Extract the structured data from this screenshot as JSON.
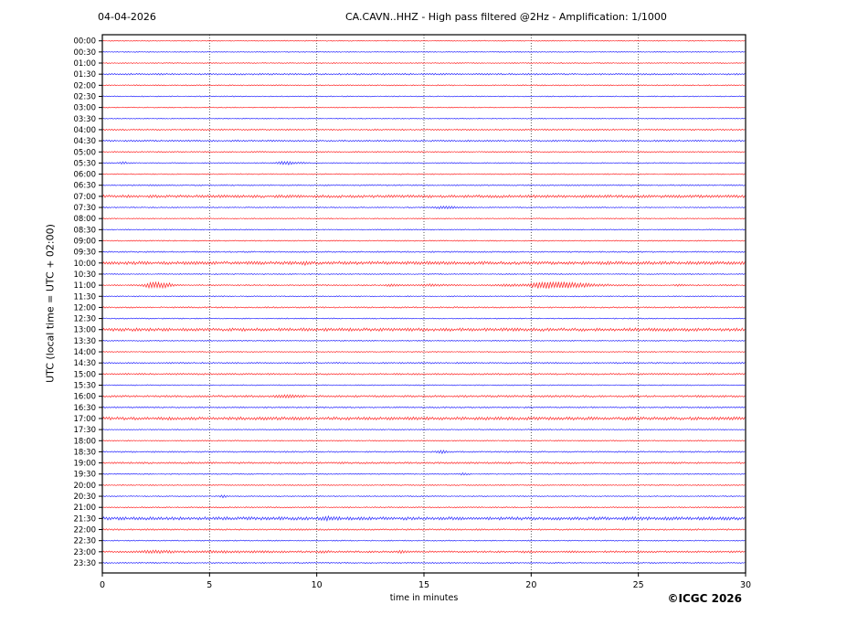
{
  "header": {
    "date": "04-04-2026",
    "title": "CA.CAVN..HHZ - High pass filtered @2Hz - Amplification: 1/1000"
  },
  "footer": {
    "copyright": "©ICGC 2026"
  },
  "chart_data": {
    "type": "line",
    "subtype": "helicorder-seismogram",
    "title": "CA.CAVN..HHZ - High pass filtered @2Hz - Amplification: 1/1000",
    "date": "04-04-2026",
    "xlabel": "time in minutes",
    "ylabel": "UTC (local time = UTC + 02:00)",
    "xlim": [
      0,
      30
    ],
    "x_ticks": [
      0,
      5,
      10,
      15,
      20,
      25,
      30
    ],
    "grid": "vertical-dotted-at-5-min",
    "legend": "none",
    "row_interval_minutes": 30,
    "colors": {
      "rows_on_hour": "#ff0000",
      "rows_on_half_hour": "#0000ff",
      "axis": "#000000",
      "grid": "#333333"
    },
    "rows": [
      {
        "label": "00:00",
        "color": "#ff0000",
        "noise": 0.5,
        "events": []
      },
      {
        "label": "00:30",
        "color": "#0000ff",
        "noise": 0.5,
        "events": []
      },
      {
        "label": "01:00",
        "color": "#ff0000",
        "noise": 0.55,
        "events": []
      },
      {
        "label": "01:30",
        "color": "#0000ff",
        "noise": 0.9,
        "events": []
      },
      {
        "label": "02:00",
        "color": "#ff0000",
        "noise": 0.6,
        "events": []
      },
      {
        "label": "02:30",
        "color": "#0000ff",
        "noise": 0.55,
        "events": []
      },
      {
        "label": "03:00",
        "color": "#ff0000",
        "noise": 0.55,
        "events": []
      },
      {
        "label": "03:30",
        "color": "#0000ff",
        "noise": 0.5,
        "events": []
      },
      {
        "label": "04:00",
        "color": "#ff0000",
        "noise": 0.8,
        "events": []
      },
      {
        "label": "04:30",
        "color": "#0000ff",
        "noise": 0.9,
        "events": []
      },
      {
        "label": "05:00",
        "color": "#ff0000",
        "noise": 0.7,
        "events": []
      },
      {
        "label": "05:30",
        "color": "#0000ff",
        "noise": 0.6,
        "events": [
          {
            "m": 1.0,
            "wl": 0.15,
            "wr": 0.15,
            "a": 1.2
          },
          {
            "m": 8.5,
            "wl": 0.25,
            "wr": 0.35,
            "a": 1.8
          },
          {
            "m": 9.3,
            "wl": 0.15,
            "wr": 0.15,
            "a": 0.9
          }
        ]
      },
      {
        "label": "06:00",
        "color": "#ff0000",
        "noise": 0.6,
        "events": []
      },
      {
        "label": "06:30",
        "color": "#0000ff",
        "noise": 0.7,
        "events": []
      },
      {
        "label": "07:00",
        "color": "#ff0000",
        "noise": 1.5,
        "events": []
      },
      {
        "label": "07:30",
        "color": "#0000ff",
        "noise": 0.6,
        "events": [
          {
            "m": 15.9,
            "wl": 0.4,
            "wr": 0.6,
            "a": 1.1
          }
        ]
      },
      {
        "label": "08:00",
        "color": "#ff0000",
        "noise": 0.55,
        "events": []
      },
      {
        "label": "08:30",
        "color": "#0000ff",
        "noise": 0.55,
        "events": []
      },
      {
        "label": "09:00",
        "color": "#ff0000",
        "noise": 0.6,
        "events": []
      },
      {
        "label": "09:30",
        "color": "#0000ff",
        "noise": 0.75,
        "events": []
      },
      {
        "label": "10:00",
        "color": "#ff0000",
        "noise": 1.7,
        "events": [
          {
            "m": 9.4,
            "wl": 0.12,
            "wr": 0.12,
            "a": 1.2
          }
        ]
      },
      {
        "label": "10:30",
        "color": "#0000ff",
        "noise": 0.6,
        "events": []
      },
      {
        "label": "11:00",
        "color": "#ff0000",
        "noise": 0.7,
        "events": [
          {
            "m": 2.35,
            "wl": 0.3,
            "wr": 0.45,
            "a": 3.2
          },
          {
            "m": 3.0,
            "wl": 0.15,
            "wr": 0.2,
            "a": 1.6
          },
          {
            "m": 13.5,
            "wl": 0.2,
            "wr": 0.3,
            "a": 0.9
          },
          {
            "m": 15.3,
            "wl": 0.5,
            "wr": 0.7,
            "a": 0.8
          },
          {
            "m": 19.0,
            "wl": 0.6,
            "wr": 0.8,
            "a": 0.9
          },
          {
            "m": 20.55,
            "wl": 0.35,
            "wr": 1.6,
            "a": 3.8
          },
          {
            "m": 26.9,
            "wl": 0.12,
            "wr": 0.12,
            "a": 0.8
          }
        ]
      },
      {
        "label": "11:30",
        "color": "#0000ff",
        "noise": 0.55,
        "events": []
      },
      {
        "label": "12:00",
        "color": "#ff0000",
        "noise": 0.8,
        "events": []
      },
      {
        "label": "12:30",
        "color": "#0000ff",
        "noise": 0.6,
        "events": []
      },
      {
        "label": "13:00",
        "color": "#ff0000",
        "noise": 1.7,
        "events": []
      },
      {
        "label": "13:30",
        "color": "#0000ff",
        "noise": 0.6,
        "events": []
      },
      {
        "label": "14:00",
        "color": "#ff0000",
        "noise": 0.55,
        "events": []
      },
      {
        "label": "14:30",
        "color": "#0000ff",
        "noise": 0.8,
        "events": []
      },
      {
        "label": "15:00",
        "color": "#ff0000",
        "noise": 0.9,
        "events": []
      },
      {
        "label": "15:30",
        "color": "#0000ff",
        "noise": 0.55,
        "events": []
      },
      {
        "label": "16:00",
        "color": "#ff0000",
        "noise": 1.1,
        "events": [
          {
            "m": 8.5,
            "wl": 0.35,
            "wr": 0.5,
            "a": 1.1
          }
        ]
      },
      {
        "label": "16:30",
        "color": "#0000ff",
        "noise": 0.8,
        "events": []
      },
      {
        "label": "17:00",
        "color": "#ff0000",
        "noise": 1.7,
        "events": []
      },
      {
        "label": "17:30",
        "color": "#0000ff",
        "noise": 0.55,
        "events": []
      },
      {
        "label": "18:00",
        "color": "#ff0000",
        "noise": 0.6,
        "events": []
      },
      {
        "label": "18:30",
        "color": "#0000ff",
        "noise": 0.8,
        "events": [
          {
            "m": 15.75,
            "wl": 0.15,
            "wr": 0.2,
            "a": 1.6
          }
        ]
      },
      {
        "label": "19:00",
        "color": "#ff0000",
        "noise": 1.0,
        "events": []
      },
      {
        "label": "19:30",
        "color": "#0000ff",
        "noise": 0.6,
        "events": [
          {
            "m": 16.85,
            "wl": 0.12,
            "wr": 0.15,
            "a": 1.3
          }
        ]
      },
      {
        "label": "20:00",
        "color": "#ff0000",
        "noise": 0.6,
        "events": []
      },
      {
        "label": "20:30",
        "color": "#0000ff",
        "noise": 0.55,
        "events": [
          {
            "m": 5.65,
            "wl": 0.12,
            "wr": 0.15,
            "a": 1.3
          }
        ]
      },
      {
        "label": "21:00",
        "color": "#ff0000",
        "noise": 0.65,
        "events": []
      },
      {
        "label": "21:30",
        "color": "#0000ff",
        "noise": 1.7,
        "events": [
          {
            "m": 10.5,
            "wl": 0.2,
            "wr": 0.3,
            "a": 1.0
          }
        ]
      },
      {
        "label": "22:00",
        "color": "#ff0000",
        "noise": 0.9,
        "events": []
      },
      {
        "label": "22:30",
        "color": "#0000ff",
        "noise": 0.6,
        "events": []
      },
      {
        "label": "23:00",
        "color": "#ff0000",
        "noise": 1.0,
        "events": [
          {
            "m": 2.3,
            "wl": 0.4,
            "wr": 0.6,
            "a": 1.0
          },
          {
            "m": 5.5,
            "wl": 1.5,
            "wr": 2.0,
            "a": 0.55
          },
          {
            "m": 10.3,
            "wl": 0.15,
            "wr": 0.2,
            "a": 0.8
          },
          {
            "m": 13.9,
            "wl": 0.15,
            "wr": 0.2,
            "a": 0.8
          },
          {
            "m": 19.8,
            "wl": 0.15,
            "wr": 0.2,
            "a": 0.7
          }
        ]
      },
      {
        "label": "23:30",
        "color": "#0000ff",
        "noise": 0.7,
        "events": []
      }
    ]
  }
}
